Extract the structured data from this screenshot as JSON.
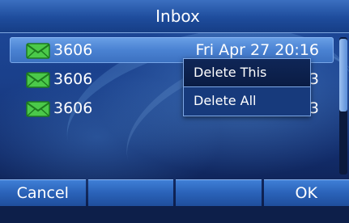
{
  "title": "Inbox",
  "messages": [
    {
      "sender": "3606",
      "date": "Fri Apr 27 20:16"
    },
    {
      "sender": "3606",
      "date": "3"
    },
    {
      "sender": "3606",
      "date": "3"
    }
  ],
  "context_menu": {
    "items": [
      "Delete This",
      "Delete All"
    ],
    "active_index": 0
  },
  "softkeys": [
    "Cancel",
    "",
    "",
    "OK"
  ],
  "icons": {
    "message": "envelope-icon"
  },
  "colors": {
    "accent": "#4a82d2",
    "background": "#1a3f8a",
    "icon": "#35b93a"
  }
}
